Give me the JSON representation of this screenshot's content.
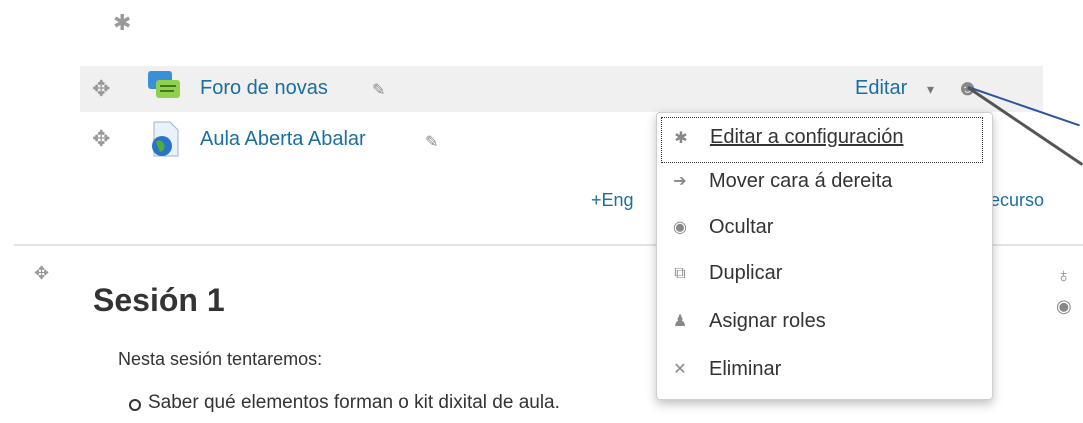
{
  "activities": [
    {
      "label": "Foro de novas"
    },
    {
      "label": "Aula Aberta Abalar"
    }
  ],
  "activity_row": {
    "editar_label": "Editar",
    "caret": "▾"
  },
  "add_activity": {
    "visible_left": "Eng",
    "visible_right": "ecurso",
    "plus": "+"
  },
  "edit_menu": {
    "items": [
      {
        "label": "Editar a configuración",
        "icon": "gear-icon"
      },
      {
        "label": "Mover cara á dereita",
        "icon": "arrow-right-icon"
      },
      {
        "label": "Ocultar",
        "icon": "eye-icon"
      },
      {
        "label": "Duplicar",
        "icon": "duplicate-icon"
      },
      {
        "label": "Asignar roles",
        "icon": "assign-roles-icon"
      },
      {
        "label": "Eliminar",
        "icon": "close-icon"
      }
    ]
  },
  "section": {
    "title": "Sesión 1",
    "summary_intro": "Nesta sesión tentaremos:",
    "bullets": [
      "Saber qué elementos forman o kit dixital de aula."
    ]
  },
  "colors": {
    "link": "#1a6fa0",
    "pointer": "#2b55a0"
  }
}
